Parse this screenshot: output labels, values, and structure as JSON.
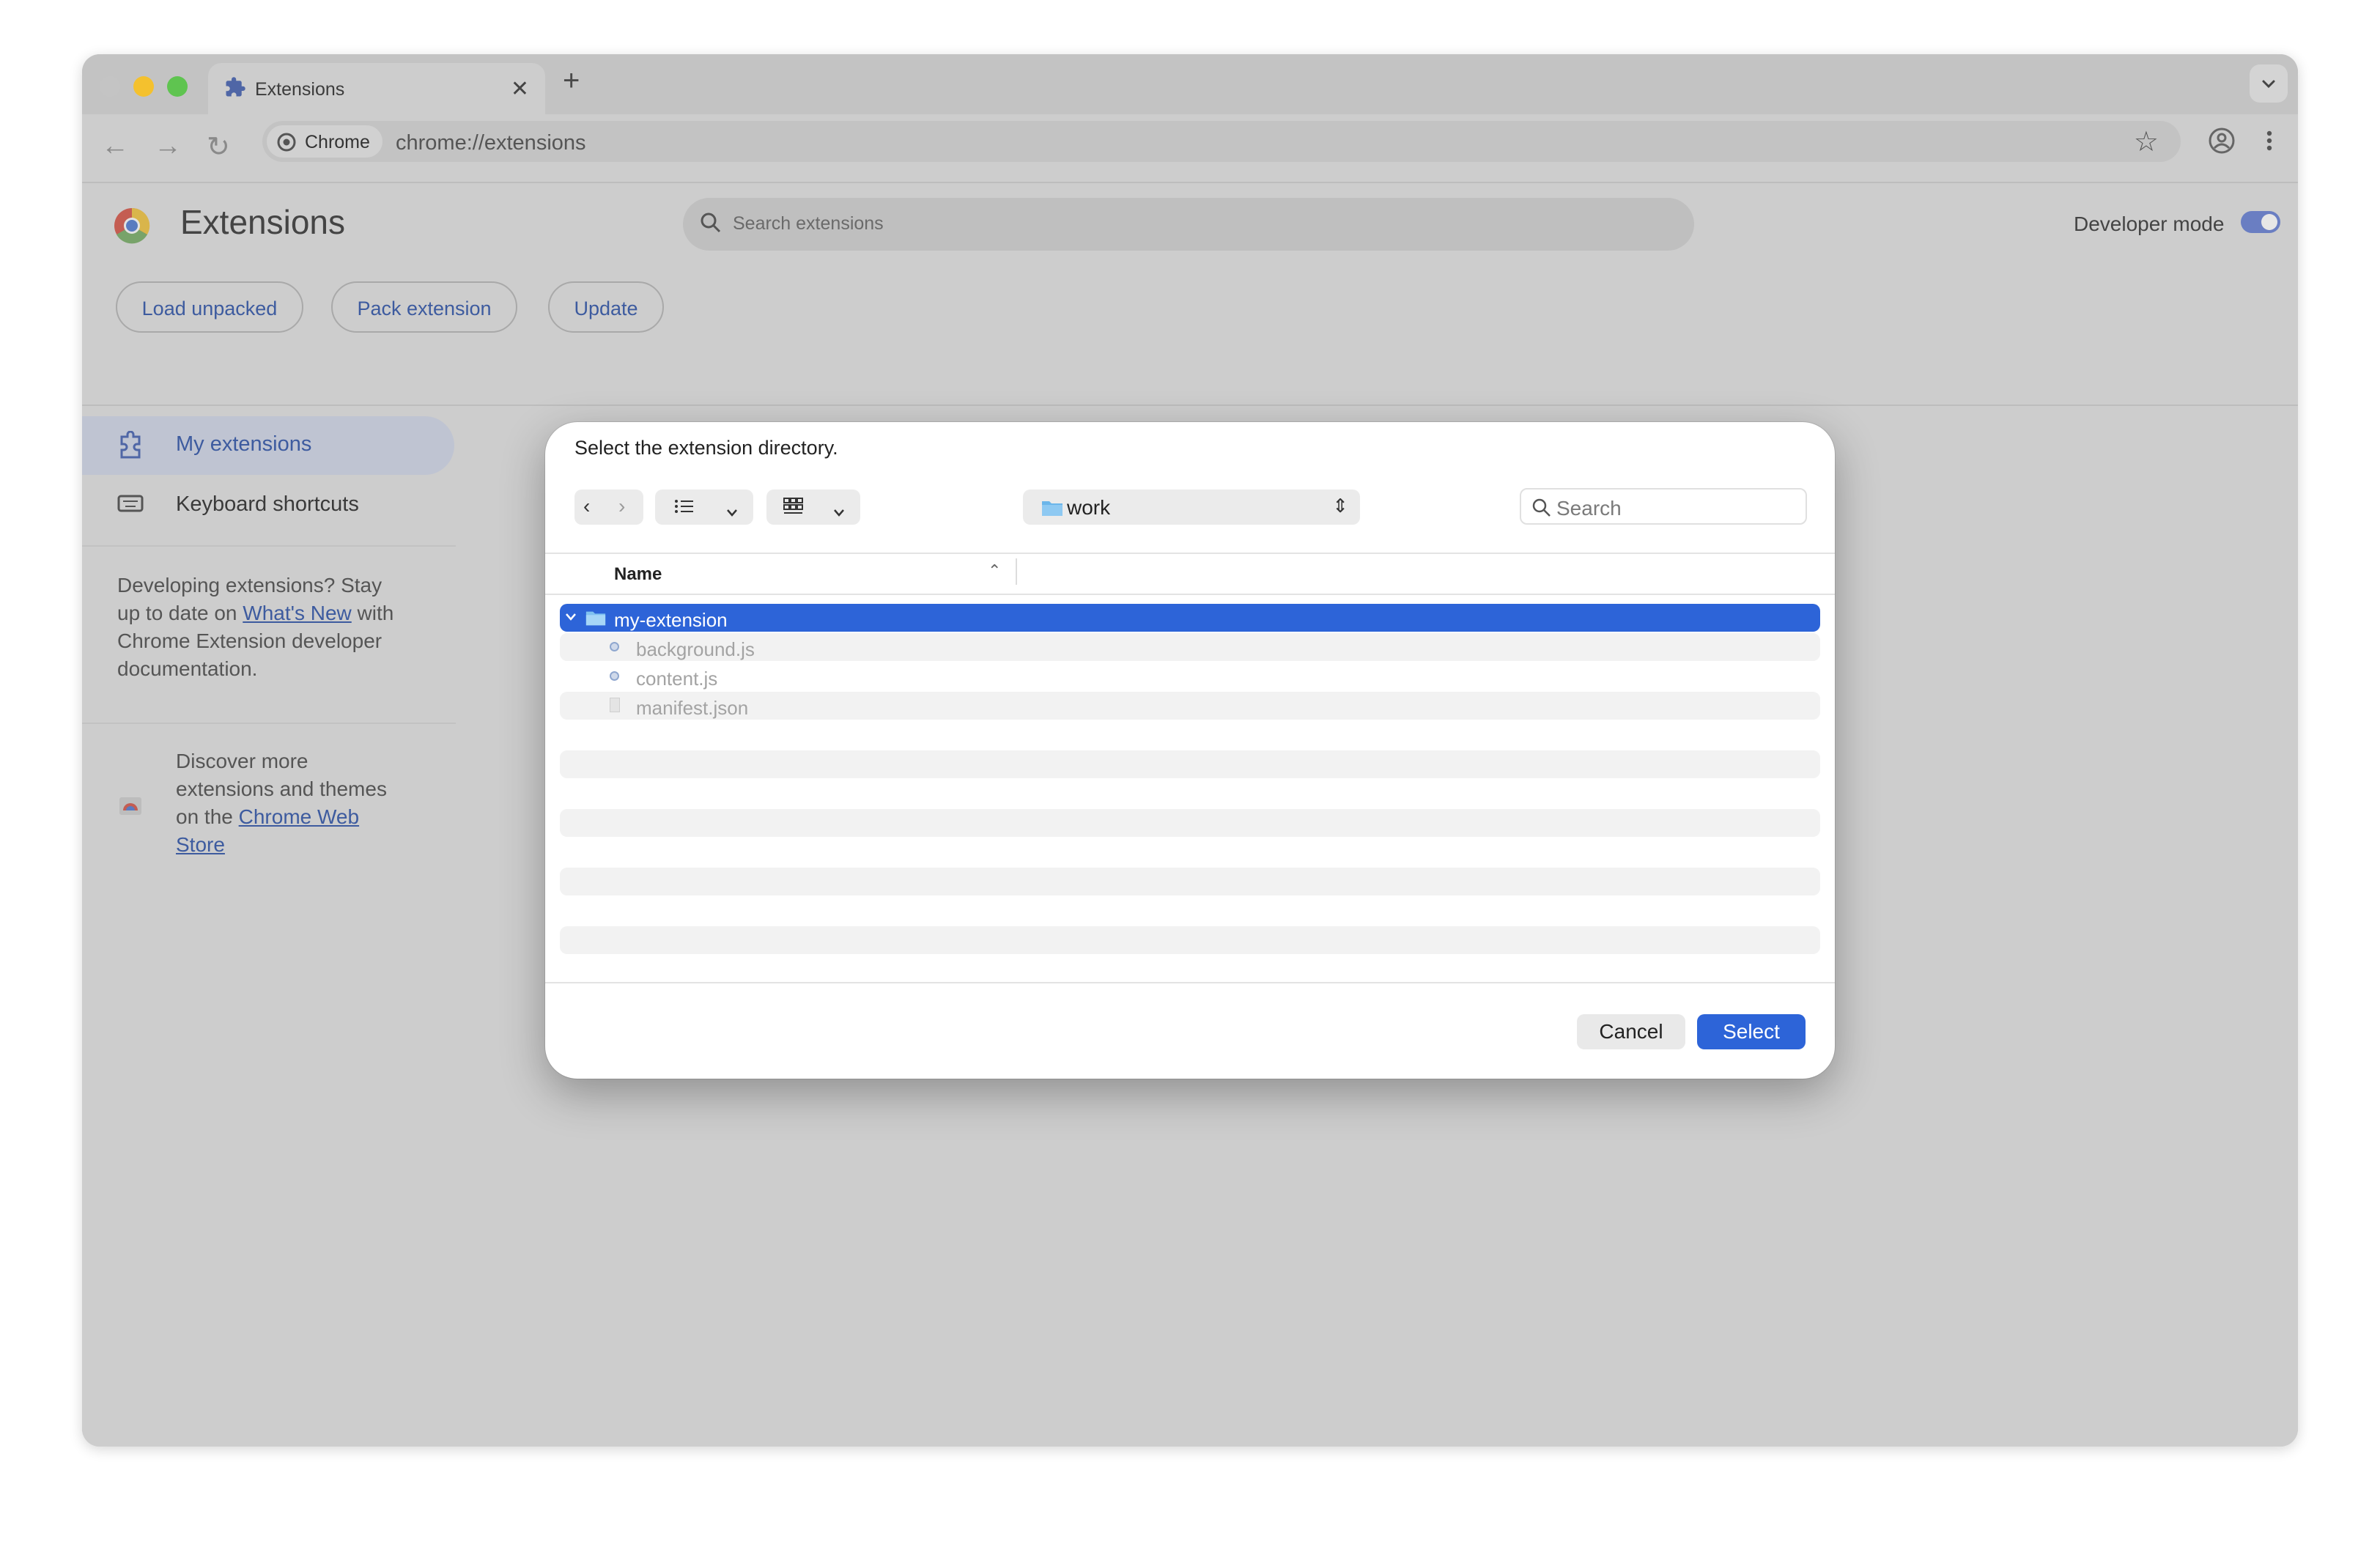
{
  "tab": {
    "title": "Extensions"
  },
  "omnibox": {
    "chip_label": "Chrome",
    "url": "chrome://extensions"
  },
  "header": {
    "title": "Extensions",
    "search_placeholder": "Search extensions",
    "developer_mode_label": "Developer mode",
    "developer_mode_on": true
  },
  "actions": {
    "load_unpacked": "Load unpacked",
    "pack_extension": "Pack extension",
    "update": "Update"
  },
  "sidebar": {
    "items": [
      {
        "label": "My extensions",
        "selected": true
      },
      {
        "label": "Keyboard shortcuts",
        "selected": false
      }
    ],
    "dev_text_1": "Developing extensions? Stay",
    "dev_text_2a": "up to date on ",
    "dev_link": "What's New",
    "dev_text_2b": " with",
    "dev_text_3": "Chrome Extension developer",
    "dev_text_4": "documentation.",
    "store_text_1": "Discover more",
    "store_text_2": "extensions and themes",
    "store_text_3a": "on the ",
    "store_link_a": "Chrome Web",
    "store_link_b": "Store"
  },
  "dialog": {
    "prompt": "Select the extension directory.",
    "location": "work",
    "search_placeholder": "Search",
    "column_name": "Name",
    "folder": "my-extension",
    "files": [
      "background.js",
      "content.js",
      "manifest.json"
    ],
    "cancel_label": "Cancel",
    "select_label": "Select"
  },
  "colors": {
    "accent": "#2d64d8",
    "link": "#3d5b9f",
    "traffic_close": "#c4c4c4",
    "traffic_minimize": "#f4c12e",
    "traffic_maximize": "#5fc450"
  }
}
